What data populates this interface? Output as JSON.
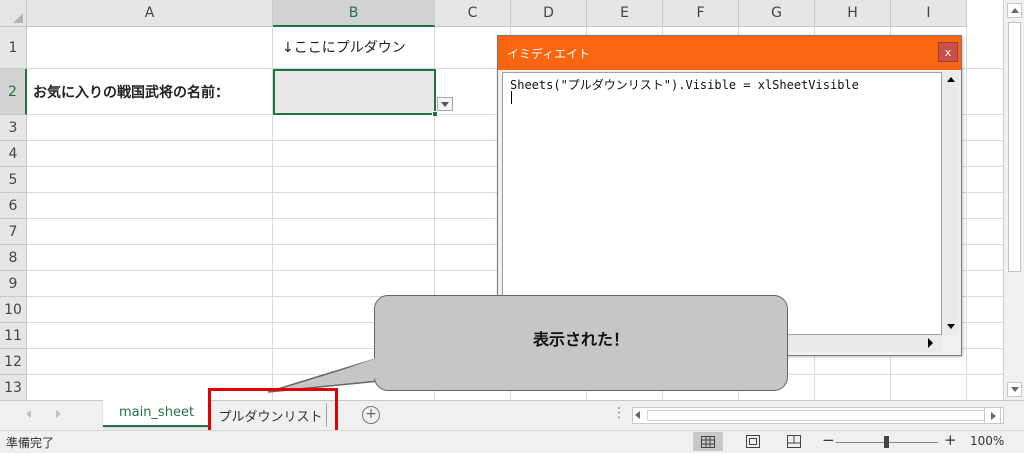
{
  "grid": {
    "columns": [
      {
        "label": "A"
      },
      {
        "label": "B"
      },
      {
        "label": "C"
      },
      {
        "label": "D"
      },
      {
        "label": "E"
      },
      {
        "label": "F"
      },
      {
        "label": "G"
      },
      {
        "label": "H"
      },
      {
        "label": "I"
      }
    ],
    "rows": [
      {
        "label": "1"
      },
      {
        "label": "2"
      },
      {
        "label": "3"
      },
      {
        "label": "4"
      },
      {
        "label": "5"
      },
      {
        "label": "6"
      },
      {
        "label": "7"
      },
      {
        "label": "8"
      },
      {
        "label": "9"
      },
      {
        "label": "10"
      },
      {
        "label": "11"
      },
      {
        "label": "12"
      },
      {
        "label": "13"
      }
    ],
    "selected_column": "B",
    "selected_row": "2",
    "cells": {
      "b1": "↓ここにプルダウン",
      "a2": "お気に入りの戦国武将の名前：",
      "b2": ""
    }
  },
  "immediate_window": {
    "title": "イミディエイト",
    "close_label": "x",
    "code": "Sheets(\"プルダウンリスト\").Visible = xlSheetVisible"
  },
  "callout": {
    "text": "表示された！"
  },
  "sheet_tabs": {
    "tabs": [
      {
        "label": "main_sheet",
        "active": true
      },
      {
        "label": "プルダウンリスト",
        "active": false
      }
    ],
    "add_label": "+",
    "dots": "⋮"
  },
  "status_bar": {
    "status": "準備完了",
    "zoom_minus": "−",
    "zoom_plus": "+",
    "zoom": "100%"
  },
  "colors": {
    "excel_green": "#217346",
    "title_orange": "#fa650f",
    "highlight_red": "#e00000",
    "callout_gray": "#c6c6c6"
  }
}
